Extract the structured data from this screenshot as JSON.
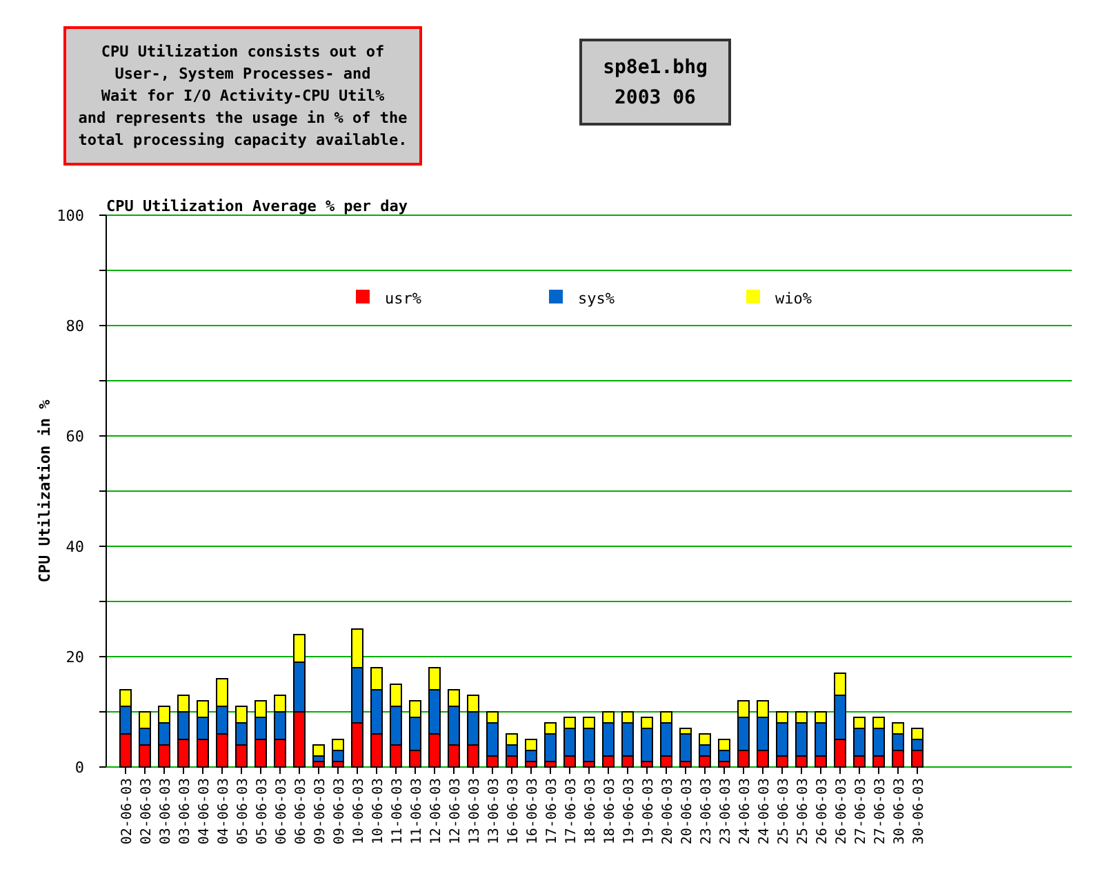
{
  "info_box": {
    "lines": [
      "CPU Utilization consists out of",
      "User-, System Processes- and",
      "Wait for I/O Activity-CPU Util%",
      "and represents the usage in % of the",
      "total processing capacity available."
    ]
  },
  "host_box": {
    "lines": [
      "sp8e1.bhg",
      "2003 06"
    ]
  },
  "chart": {
    "chart_data": {
      "type": "bar",
      "title": "CPU Utilization Average % per day",
      "ylabel": "CPU Utilization in %",
      "stacked": true,
      "grid": true,
      "legend": "inside-top",
      "ylim": [
        0,
        100
      ],
      "yticks": [
        0,
        20,
        40,
        60,
        80,
        100
      ],
      "categories": [
        "02-06-03",
        "02-06-03",
        "03-06-03",
        "03-06-03",
        "04-06-03",
        "04-06-03",
        "05-06-03",
        "05-06-03",
        "06-06-03",
        "06-06-03",
        "09-06-03",
        "09-06-03",
        "10-06-03",
        "10-06-03",
        "11-06-03",
        "11-06-03",
        "12-06-03",
        "12-06-03",
        "13-06-03",
        "13-06-03",
        "16-06-03",
        "16-06-03",
        "17-06-03",
        "17-06-03",
        "18-06-03",
        "18-06-03",
        "19-06-03",
        "19-06-03",
        "20-06-03",
        "20-06-03",
        "23-06-03",
        "23-06-03",
        "24-06-03",
        "24-06-03",
        "25-06-03",
        "25-06-03",
        "26-06-03",
        "26-06-03",
        "27-06-03",
        "27-06-03",
        "30-06-03",
        "30-06-03"
      ],
      "series": [
        {
          "name": "usr%",
          "color": "#ff0000",
          "values": [
            6,
            4,
            4,
            5,
            5,
            6,
            4,
            5,
            5,
            10,
            1,
            1,
            8,
            6,
            4,
            3,
            6,
            4,
            4,
            2,
            2,
            1,
            1,
            2,
            1,
            2,
            2,
            1,
            2,
            1,
            2,
            1,
            3,
            3,
            2,
            2,
            2,
            5,
            2,
            2,
            3,
            3
          ]
        },
        {
          "name": "sys%",
          "color": "#0066cc",
          "values": [
            5,
            3,
            4,
            5,
            4,
            5,
            4,
            4,
            5,
            9,
            1,
            2,
            10,
            8,
            7,
            6,
            8,
            7,
            6,
            6,
            2,
            2,
            5,
            5,
            6,
            6,
            6,
            6,
            6,
            5,
            2,
            2,
            6,
            6,
            6,
            6,
            6,
            8,
            5,
            5,
            3,
            2
          ]
        },
        {
          "name": "wio%",
          "color": "#ffff00",
          "values": [
            3,
            3,
            3,
            3,
            3,
            5,
            3,
            3,
            3,
            5,
            2,
            2,
            7,
            4,
            4,
            3,
            4,
            3,
            3,
            2,
            2,
            2,
            2,
            2,
            2,
            2,
            2,
            2,
            2,
            1,
            2,
            2,
            3,
            3,
            2,
            2,
            2,
            4,
            2,
            2,
            2,
            2
          ]
        }
      ]
    }
  }
}
